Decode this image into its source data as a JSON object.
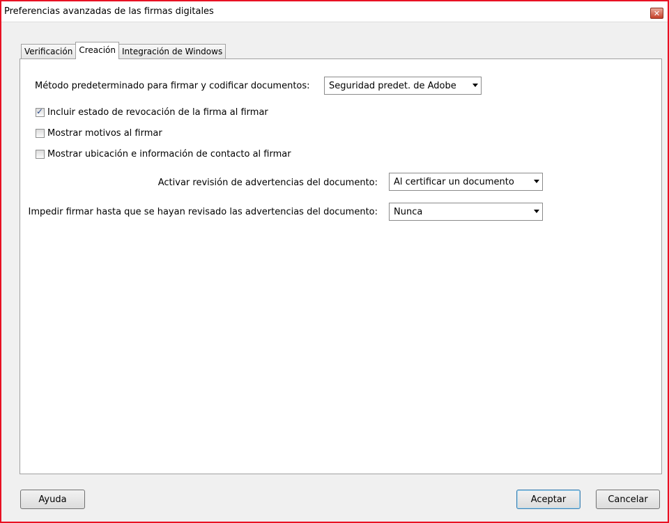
{
  "window": {
    "title": "Preferencias avanzadas de las firmas digitales",
    "close_glyph": "✕"
  },
  "tabs": [
    {
      "label": "Verificación"
    },
    {
      "label": "Creación",
      "active": true
    },
    {
      "label": "Integración de Windows"
    }
  ],
  "creation": {
    "default_method_label": "Método predeterminado para firmar y codificar documentos:",
    "default_method_value": "Seguridad predet. de Adobe",
    "checkboxes": [
      {
        "label": "Incluir estado de revocación de la firma al firmar",
        "checked": true
      },
      {
        "label": "Mostrar motivos al firmar",
        "checked": false
      },
      {
        "label": "Mostrar ubicación e información de contacto al firmar",
        "checked": false
      }
    ],
    "warnings_review_label": "Activar revisión de advertencias del documento:",
    "warnings_review_value": "Al certificar un documento",
    "prevent_signing_label": "Impedir firmar hasta que se hayan revisado las advertencias del documento:",
    "prevent_signing_value": "Nunca"
  },
  "buttons": {
    "help": "Ayuda",
    "ok": "Aceptar",
    "cancel": "Cancelar"
  },
  "colors": {
    "frame_border": "#e81123",
    "default_button_border": "#3c7fb1"
  }
}
